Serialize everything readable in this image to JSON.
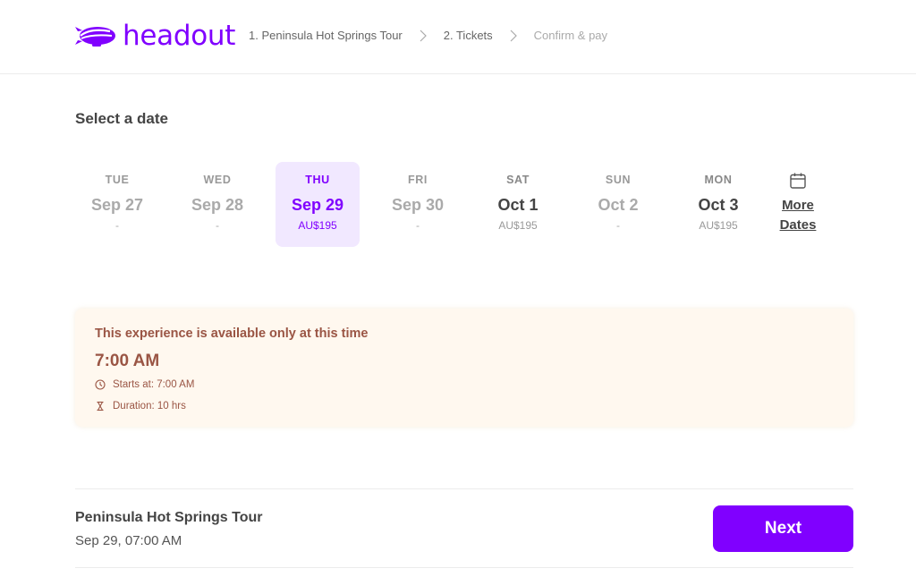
{
  "header": {
    "brand": "headout",
    "brand_color": "#8000ff",
    "logo_icon": "blimp-icon",
    "breadcrumb": [
      {
        "label": "1. Peninsula Hot Springs Tour",
        "state": "done"
      },
      {
        "label": "2. Tickets",
        "state": "current"
      },
      {
        "label": "Confirm & pay",
        "state": "pending"
      }
    ],
    "separator_icon": "chevron-right-icon"
  },
  "date_picker": {
    "title": "Select a date",
    "dates": [
      {
        "dow": "TUE",
        "day": "Sep 27",
        "price": "-",
        "state": "unavailable"
      },
      {
        "dow": "WED",
        "day": "Sep 28",
        "price": "-",
        "state": "unavailable"
      },
      {
        "dow": "THU",
        "day": "Sep 29",
        "price": "AU$195",
        "state": "selected"
      },
      {
        "dow": "FRI",
        "day": "Sep 30",
        "price": "-",
        "state": "unavailable"
      },
      {
        "dow": "SAT",
        "day": "Oct 1",
        "price": "AU$195",
        "state": "available"
      },
      {
        "dow": "SUN",
        "day": "Oct 2",
        "price": "-",
        "state": "unavailable"
      },
      {
        "dow": "MON",
        "day": "Oct 3",
        "price": "AU$195",
        "state": "available"
      }
    ],
    "more_dates": {
      "icon": "calendar-icon",
      "line1": "More",
      "line2": "Dates"
    }
  },
  "availability": {
    "title": "This experience is available only at this time",
    "time": "7:00 AM",
    "starts_at": "Starts at: 7:00 AM",
    "duration": "Duration: 10 hrs",
    "text_color": "#9a5544",
    "bg_color": "#fff8ef"
  },
  "footer": {
    "tour_name": "Peninsula Hot Springs Tour",
    "tour_datetime": "Sep 29, 07:00 AM",
    "next_label": "Next"
  }
}
